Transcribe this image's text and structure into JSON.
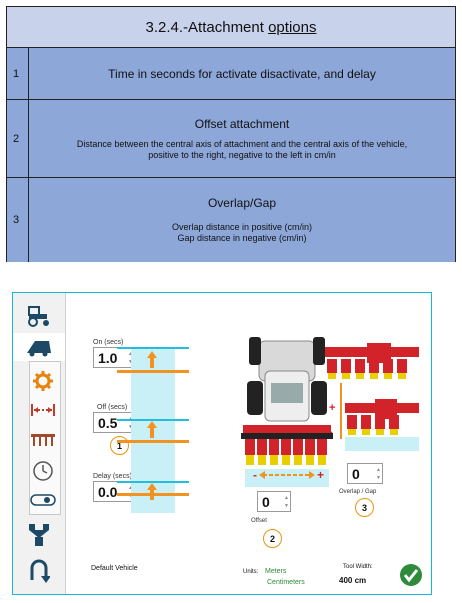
{
  "doc": {
    "title_prefix": "3.2.4.-Attachment ",
    "title_underlined": "options",
    "rows": [
      {
        "num": "1",
        "title": "Time in seconds for activate disactivate, and delay"
      },
      {
        "num": "2",
        "title": "Offset attachment",
        "desc1": "Distance between the central axis of attachment and the central axis of the vehicle,",
        "desc2": "positive to the right, negative to the left in cm/in"
      },
      {
        "num": "3",
        "title": "Overlap/Gap",
        "desc1": "Overlap distance in positive (cm/in)",
        "desc2": "Gap distance in negative (cm/in)"
      }
    ]
  },
  "app": {
    "timing": {
      "on_label": "On (secs)",
      "on_value": "1.0",
      "off_label": "Off (secs)",
      "off_value": "0.5",
      "delay_label": "Delay (secs)",
      "delay_value": "0.0"
    },
    "offset": {
      "value": "0",
      "label": "Offset"
    },
    "overlap": {
      "value": "0",
      "label": "Overlap / Gap"
    },
    "badges": [
      "1",
      "2",
      "3"
    ],
    "status": {
      "vehicle": "Default Vehicle",
      "units_label": "Units:",
      "unit1": "Meters",
      "unit2": "Centimeters",
      "tool_width_label": "Tool Width:",
      "tool_width_value": "400 cm"
    },
    "icons": [
      "tractor-icon",
      "seeder-icon",
      "gear-icon",
      "width-arrows-icon",
      "boom-icon",
      "clock-icon",
      "toggle-icon",
      "tramline-icon",
      "u-turn-icon",
      "confirm-check-icon"
    ],
    "colors": {
      "accent": "#18b7d9",
      "orange": "#f29321",
      "red": "#d2232a",
      "green": "#2e8b3a",
      "table_light": "#c8d3eb",
      "table_dark": "#8ea7d9"
    }
  }
}
